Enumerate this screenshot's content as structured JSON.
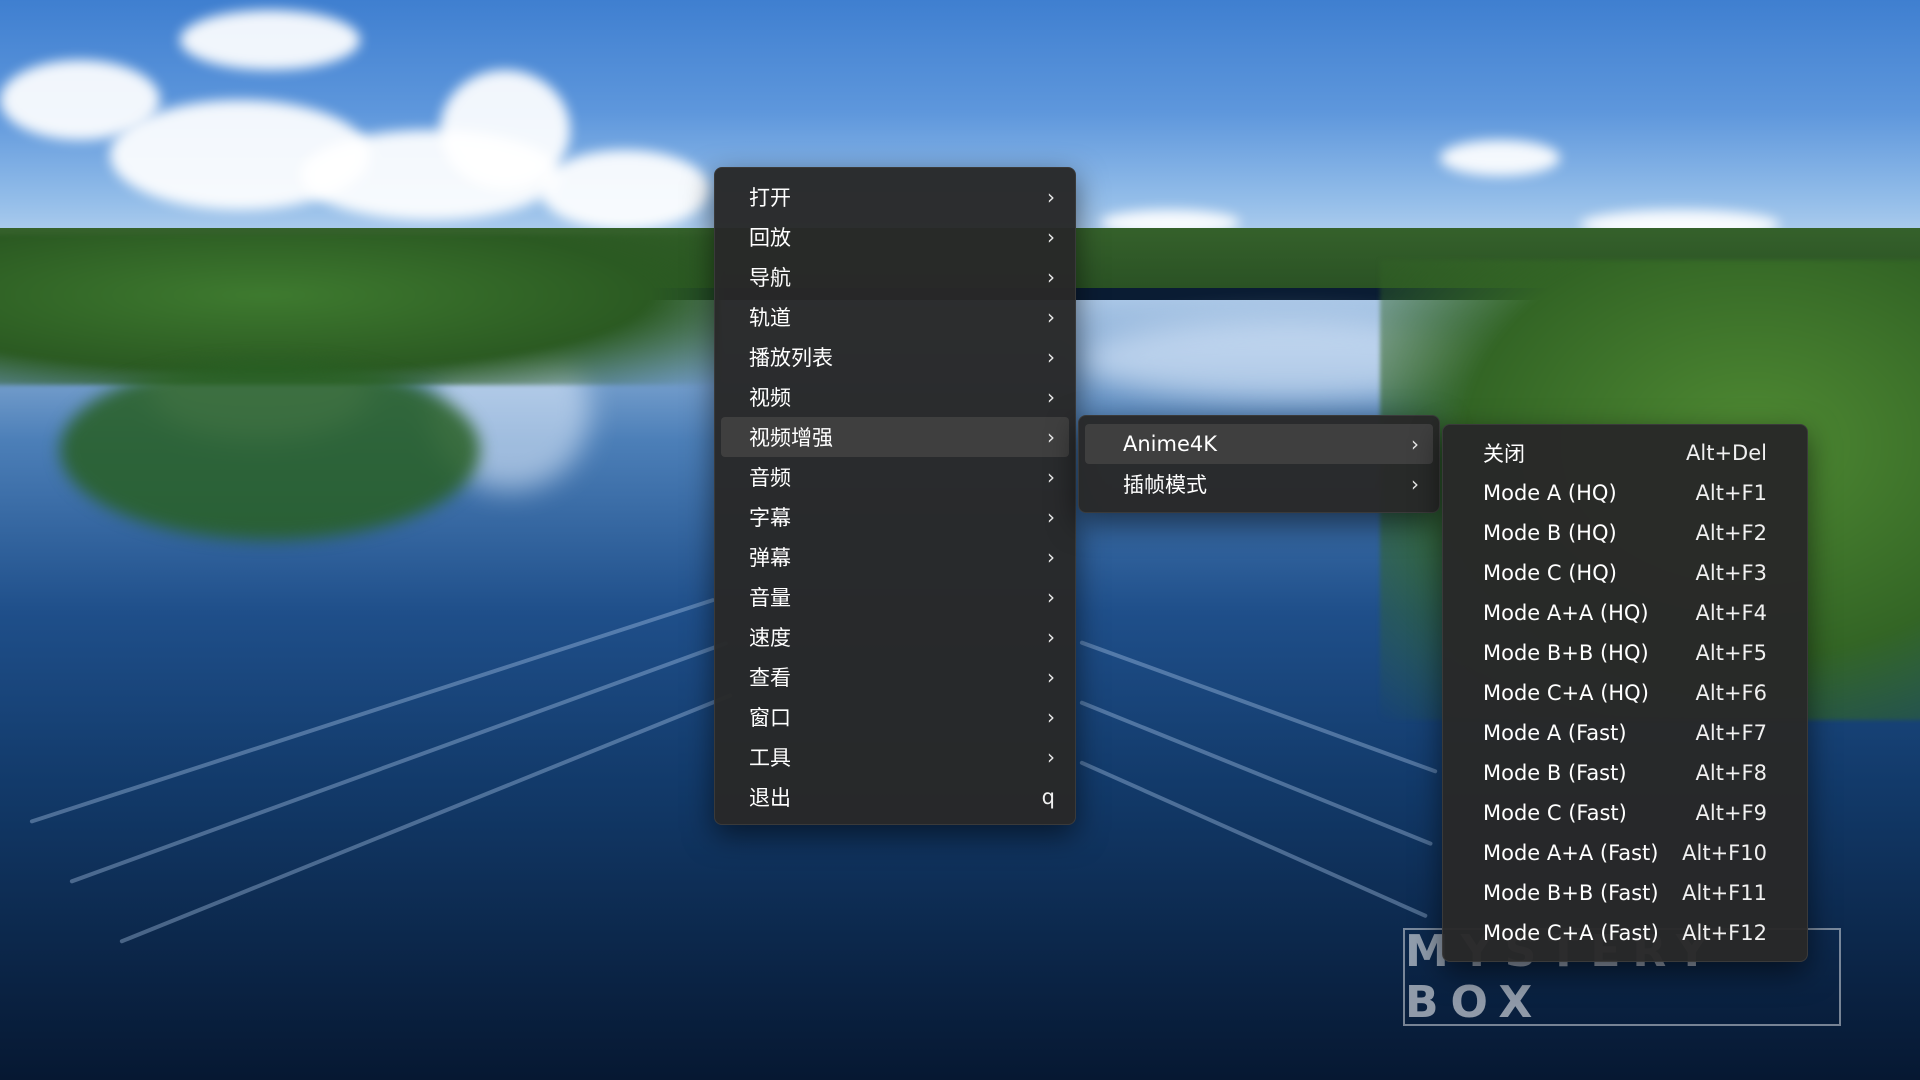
{
  "main_menu": {
    "items": [
      {
        "label": "打开",
        "has_submenu": true
      },
      {
        "label": "回放",
        "has_submenu": true
      },
      {
        "label": "导航",
        "has_submenu": true
      },
      {
        "label": "轨道",
        "has_submenu": true
      },
      {
        "label": "播放列表",
        "has_submenu": true
      },
      {
        "label": "视频",
        "has_submenu": true
      },
      {
        "label": "视频增强",
        "has_submenu": true,
        "highlighted": true
      },
      {
        "label": "音频",
        "has_submenu": true
      },
      {
        "label": "字幕",
        "has_submenu": true
      },
      {
        "label": "弹幕",
        "has_submenu": true
      },
      {
        "label": "音量",
        "has_submenu": true
      },
      {
        "label": "速度",
        "has_submenu": true
      },
      {
        "label": "查看",
        "has_submenu": true
      },
      {
        "label": "窗口",
        "has_submenu": true
      },
      {
        "label": "工具",
        "has_submenu": true
      },
      {
        "label": "退出",
        "shortcut": "q"
      }
    ],
    "chevron": "›"
  },
  "video_enhance_menu": {
    "items": [
      {
        "label": "Anime4K",
        "has_submenu": true,
        "highlighted": true
      },
      {
        "label": "插帧模式",
        "has_submenu": true
      }
    ]
  },
  "anime4k_menu": {
    "items": [
      {
        "label": "关闭",
        "shortcut": "Alt+Del"
      },
      {
        "label": "Mode A (HQ)",
        "shortcut": "Alt+F1"
      },
      {
        "label": "Mode B (HQ)",
        "shortcut": "Alt+F2"
      },
      {
        "label": "Mode C (HQ)",
        "shortcut": "Alt+F3"
      },
      {
        "label": "Mode A+A (HQ)",
        "shortcut": "Alt+F4"
      },
      {
        "label": "Mode B+B (HQ)",
        "shortcut": "Alt+F5"
      },
      {
        "label": "Mode C+A (HQ)",
        "shortcut": "Alt+F6"
      },
      {
        "label": "Mode A (Fast)",
        "shortcut": "Alt+F7"
      },
      {
        "label": "Mode B (Fast)",
        "shortcut": "Alt+F8"
      },
      {
        "label": "Mode C (Fast)",
        "shortcut": "Alt+F9"
      },
      {
        "label": "Mode A+A (Fast)",
        "shortcut": "Alt+F10"
      },
      {
        "label": "Mode B+B (Fast)",
        "shortcut": "Alt+F11"
      },
      {
        "label": "Mode C+A (Fast)",
        "shortcut": "Alt+F12"
      }
    ]
  },
  "watermark": {
    "text": "MYSTERY BOX"
  },
  "colors": {
    "menu_background": "#282828",
    "menu_highlight": "#3f3f3f",
    "menu_text": "#ffffff"
  }
}
